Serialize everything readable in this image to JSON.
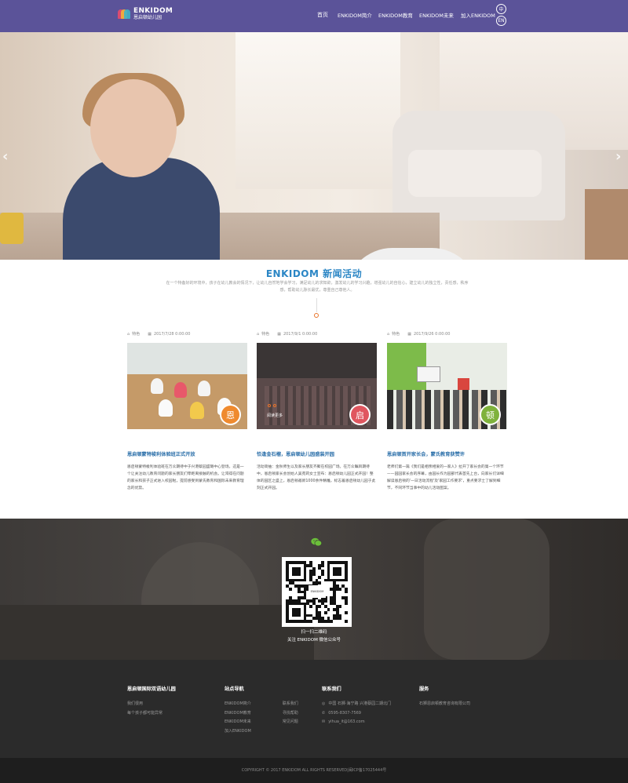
{
  "brand": {
    "name": "ENKIDOM",
    "subtitle": "恩启顿幼儿园"
  },
  "nav": {
    "items": [
      "首页",
      "ENKIDOM简介",
      "ENKIDOM教育",
      "ENKIDOM未来",
      "加入ENKIDOM"
    ],
    "lang_zh": "中",
    "lang_en": "EN"
  },
  "hero": {
    "prev": "‹",
    "next": "›"
  },
  "news": {
    "title": "ENKIDOM 新闻活动",
    "description": "在一个特备好的环境中，孩子在幼儿教会的情况下，让幼儿自然地学会学习，满足幼儿的求知欲，激发幼儿的学习兴趣，增强幼儿的自信心，建立幼儿的独立性，责任感，秩序感，帮助幼儿脉长最优，尊重自己尊他人。",
    "cards": [
      {
        "tag": "特色",
        "date": "2017/7/28 0:00:00",
        "badge": "恩",
        "badge_color": "#ef8a2e",
        "title": "恩启顿蒙特梭利体验班正式开放",
        "text": "恩启顿蒙特梭利体验班在万众期待中于兴港蔡园盛璐中心登场。这是一个让关注幼儿教育问题的家长朋友们零距离接触的机会。让渴得在问题的家长和孩子正式进入校园啦，提前感受到蒙氏教育和国际未来教育理念的优势。"
      },
      {
        "tag": "特色",
        "date": "2017/9/1 0:00:00",
        "badge": "启",
        "badge_color": "#e0565f",
        "overlay": "阅读更多",
        "title": "恰逢金石榴，恩启顿幼儿园盛装开园",
        "text": "活动简抽：金秋师生以及家长朋友齐聚在校园广场。在万众瞩目期待中，恩启顿家长会创始人吴苑莉女士宣布：恩启顿幼儿园正式开园！整体的园区之盛上，恩启顿邀新1000余件精雕，标志着恩启顿幼儿园于此刻正式开园。"
      },
      {
        "tag": "特色",
        "date": "2017/9/26 0:00:00",
        "badge": "顿",
        "badge_color": "#7fb23c",
        "title": "恩启顿首开家长会，蒙氏教育获赞许",
        "text": "老师们第一篇《我们是相亲相爱的一家人》拉开了家长会的第一个环节——园园家长会的序幕，由园长作为园部代表首先上台，向家长们详细解读恩启顿的'一日活动流程'及'家园工作要求'，重点要求士了解到细节，不同环节当事中的幼儿活动图案。"
      }
    ]
  },
  "qr": {
    "line1": "扫一扫二维码",
    "line2": "关注 ENKIDOM 微信公众号",
    "label": "ENKIDOM"
  },
  "footer": {
    "col1": {
      "title": "恩启顿国际双语幼儿园",
      "lines": [
        "我们很用",
        "每个孩子都可能异常"
      ]
    },
    "col2": {
      "title": "站点导航",
      "left": [
        "ENKIDOM简介",
        "ENKIDOM教育",
        "ENKIDOM未来",
        "加入ENKIDOM"
      ],
      "right": [
        "联系我们",
        "寻找帮助",
        "常见问题"
      ]
    },
    "col3": {
      "title": "联系我们",
      "address": "中国 石狮·海宁路 兴港蔡园二期北门",
      "phone": "0595-8307-7569",
      "email": "yihua_it@163.com"
    },
    "col4": {
      "title": "服务",
      "lines": [
        "石狮恩启顿教育咨询有限公司"
      ]
    },
    "copyright": "COPYRIGHT © 2017 ENKIDOM ALL RIGHTS RESERVED|闽ICP备17025444号"
  },
  "colors": {
    "nav_bg": "#5b5399",
    "accent_blue": "#2b86c5",
    "footer_bg": "#2b2b2b"
  }
}
